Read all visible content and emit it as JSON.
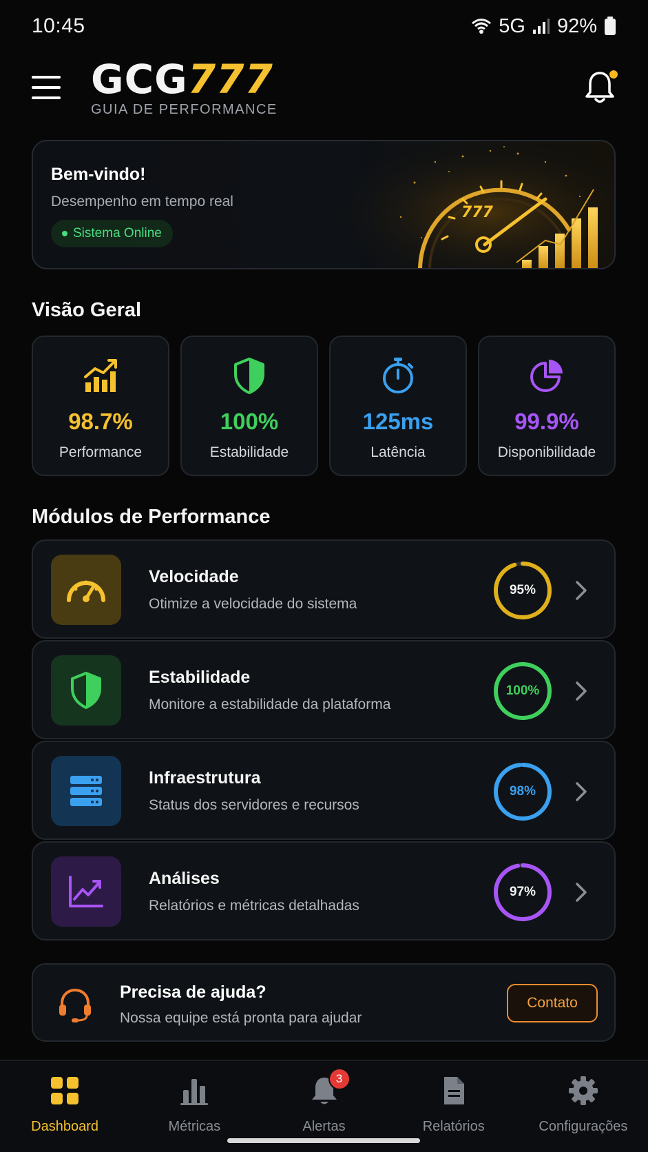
{
  "status_bar": {
    "time": "10:45",
    "network": "5G",
    "battery": "92%"
  },
  "header": {
    "logo_main_a": "GCG",
    "logo_main_b": "777",
    "logo_sub": "GUIA DE PERFORMANCE"
  },
  "welcome": {
    "title": "Bem-vindo!",
    "subtitle": "Desempenho em tempo real",
    "status": "Sistema Online",
    "gauge_value": "777"
  },
  "overview": {
    "title": "Visão Geral",
    "stats": [
      {
        "value": "98.7%",
        "label": "Performance",
        "color": "#f5c12e",
        "icon": "chart-growth-icon"
      },
      {
        "value": "100%",
        "label": "Estabilidade",
        "color": "#3fcf5c",
        "icon": "shield-icon"
      },
      {
        "value": "125ms",
        "label": "Latência",
        "color": "#3aa0f0",
        "icon": "stopwatch-icon"
      },
      {
        "value": "99.9%",
        "label": "Disponibilidade",
        "color": "#a855f7",
        "icon": "pie-chart-icon"
      }
    ]
  },
  "modules": {
    "title": "Módulos de Performance",
    "items": [
      {
        "title": "Velocidade",
        "desc": "Otimize a velocidade do sistema",
        "percent": "95%",
        "progress": 0.95,
        "color": "#e0b01c",
        "icon": "speedometer-icon"
      },
      {
        "title": "Estabilidade",
        "desc": "Monitore a estabilidade da plataforma",
        "percent": "100%",
        "progress": 1.0,
        "color": "#3fcf5c",
        "icon": "shield-icon"
      },
      {
        "title": "Infraestrutura",
        "desc": "Status dos servidores e recursos",
        "percent": "98%",
        "progress": 0.98,
        "color": "#3aa0f0",
        "icon": "server-icon"
      },
      {
        "title": "Análises",
        "desc": "Relatórios e métricas detalhadas",
        "percent": "97%",
        "progress": 0.97,
        "color": "#a855f7",
        "icon": "trend-chart-icon"
      }
    ]
  },
  "help": {
    "title": "Precisa de ajuda?",
    "subtitle": "Nossa equipe está pronta para ajudar",
    "button": "Contato"
  },
  "nav": {
    "items": [
      {
        "label": "Dashboard",
        "icon": "grid-icon",
        "active": true
      },
      {
        "label": "Métricas",
        "icon": "bar-chart-icon"
      },
      {
        "label": "Alertas",
        "icon": "bell-icon",
        "badge": "3"
      },
      {
        "label": "Relatórios",
        "icon": "document-icon"
      },
      {
        "label": "Configurações",
        "icon": "gear-icon"
      }
    ]
  }
}
